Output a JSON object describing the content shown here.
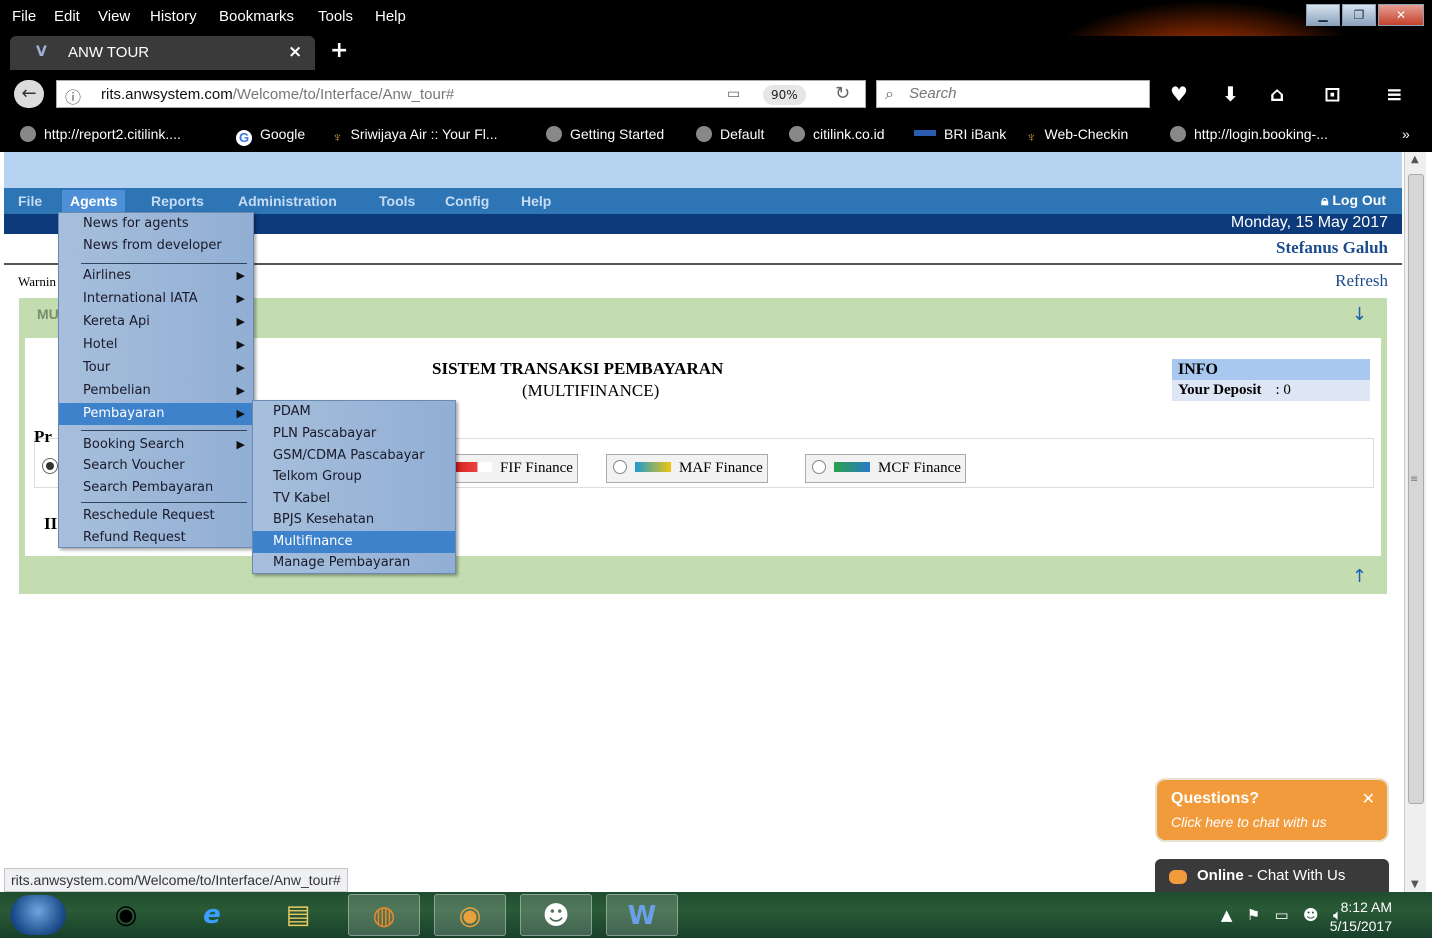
{
  "browser": {
    "menu": [
      "File",
      "Edit",
      "View",
      "History",
      "Bookmarks",
      "Tools",
      "Help"
    ],
    "tab_title": "ANW TOUR",
    "url_host": "rits.anwsystem.com",
    "url_path": "/Welcome/to/Interface/Anw_tour#",
    "zoom": "90%",
    "search_placeholder": "Search",
    "bookmarks": [
      "http://report2.citilink....",
      "Google",
      "Sriwijaya Air :: Your Fl...",
      "Getting Started",
      "Default",
      "citilink.co.id",
      "BRI iBank",
      "Web-Checkin",
      "http://login.booking-..."
    ],
    "overflow": "»",
    "status_url": "rits.anwsystem.com/Welcome/to/Interface/Anw_tour#"
  },
  "app": {
    "menu": [
      "File",
      "Agents",
      "Reports",
      "Administration",
      "Tools",
      "Config",
      "Help"
    ],
    "logout": "Log Out",
    "date": "Monday, 15 May 2017",
    "user": "Stefanus Galuh",
    "warning": "Warnin",
    "refresh": "Refresh",
    "panel_title": "MU",
    "title": "SISTEM TRANSAKSI PEMBAYARAN",
    "subtitle": "(MULTIFINANCE)",
    "info": {
      "heading": "INFO",
      "deposit_label": "Your Deposit",
      "deposit_value": ": 0"
    },
    "provider_label": "Pr",
    "section2_label": "II",
    "providers": [
      "FIF Finance",
      "MAF Finance",
      "MCF Finance"
    ]
  },
  "agents_menu": {
    "items": [
      "News for agents",
      "News from developer",
      "Airlines",
      "International IATA",
      "Kereta Api",
      "Hotel",
      "Tour",
      "Pembelian",
      "Pembayaran",
      "Booking Search",
      "Search Voucher",
      "Search Pembayaran",
      "Reschedule Request",
      "Refund Request"
    ]
  },
  "pembayaran_menu": {
    "items": [
      "PDAM",
      "PLN Pascabayar",
      "GSM/CDMA Pascabayar",
      "Telkom Group",
      "TV Kabel",
      "BPJS Kesehatan",
      "Multifinance",
      "Manage Pembayaran"
    ]
  },
  "chat": {
    "question": "Questions?",
    "sub": "Click here to chat with us",
    "online_bold": "Online",
    "online_rest": " - Chat With Us"
  },
  "taskbar": {
    "time": "8:12 AM",
    "date": "5/15/2017"
  },
  "colors": {
    "app_menu": "#2e75b6",
    "date_band": "#0d3a7a",
    "panel_green": "#c4ddb0",
    "menu_highlight": "#3f82cc",
    "chat_orange": "#f29b3c"
  }
}
